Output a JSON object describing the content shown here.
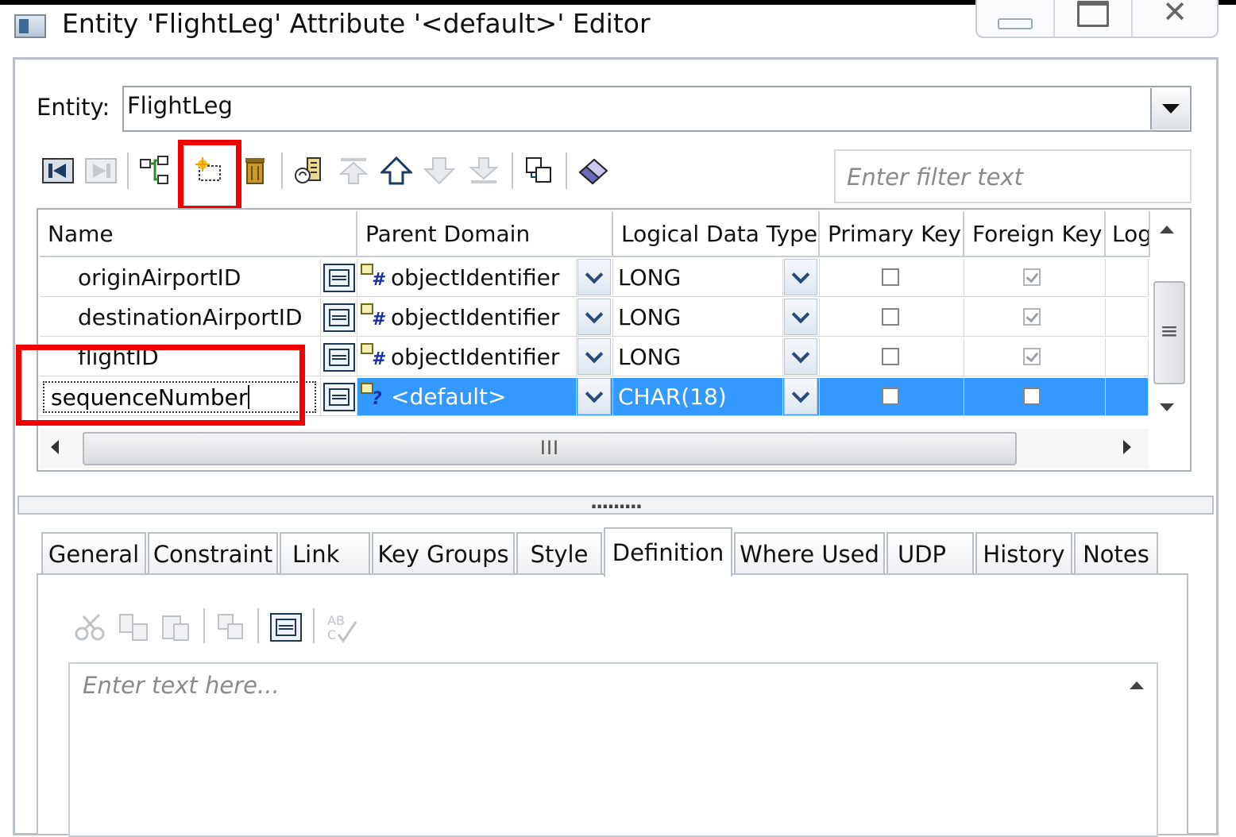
{
  "window": {
    "title": "Entity 'FlightLeg' Attribute '<default>' Editor",
    "controls": [
      "minimize",
      "maximize",
      "close"
    ]
  },
  "entity": {
    "label": "Entity:",
    "value": "FlightLeg"
  },
  "toolbar": {
    "buttons": [
      "first-icon",
      "last-icon",
      "hierarchy-icon",
      "new-attribute-icon",
      "delete-icon",
      "migrate-icon",
      "move-top-icon",
      "move-up-icon",
      "move-down-icon",
      "move-bottom-icon",
      "copy-icon",
      "eraser-icon"
    ],
    "filter_placeholder": "Enter filter text"
  },
  "grid": {
    "columns": [
      "Name",
      "Parent Domain",
      "Logical Data Type",
      "Primary Key",
      "Foreign Key",
      "Log"
    ],
    "rows": [
      {
        "name": "originAirportID",
        "domain": "objectIdentifier",
        "domain_symbol": "#",
        "type": "LONG",
        "primary_key": false,
        "foreign_key": true,
        "selected": false
      },
      {
        "name": "destinationAirportID",
        "domain": "objectIdentifier",
        "domain_symbol": "#",
        "type": "LONG",
        "primary_key": false,
        "foreign_key": true,
        "selected": false
      },
      {
        "name": "flightID",
        "domain": "objectIdentifier",
        "domain_symbol": "#",
        "type": "LONG",
        "primary_key": false,
        "foreign_key": true,
        "selected": false
      },
      {
        "name": "sequenceNumber",
        "domain": "<default>",
        "domain_symbol": "?",
        "type": "CHAR(18)",
        "primary_key": false,
        "foreign_key": false,
        "selected": true
      }
    ],
    "hscroll_grip": "III",
    "vscroll_grip": "≡"
  },
  "splitter": {
    "grip": "........."
  },
  "tabs": {
    "items": [
      "General",
      "Constraint",
      "Link",
      "Key Groups",
      "Style",
      "Definition",
      "Where Used",
      "UDP",
      "History",
      "Notes"
    ],
    "active": "Definition"
  },
  "definition": {
    "toolbar": [
      "cut-icon",
      "copy-icon",
      "paste-icon",
      "copy-from-icon",
      "expand-icon",
      "spellcheck-icon"
    ],
    "placeholder": "Enter text here..."
  },
  "colors": {
    "selection": "#3399ff",
    "highlight": "#f20000"
  }
}
